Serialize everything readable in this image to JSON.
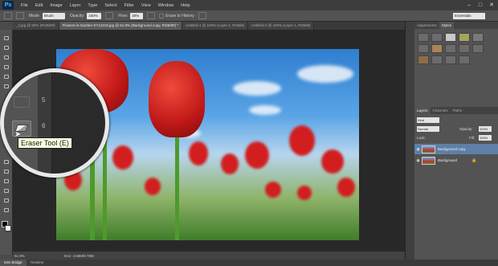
{
  "app": {
    "logo": "Ps"
  },
  "menu": [
    "File",
    "Edit",
    "Image",
    "Layer",
    "Type",
    "Select",
    "Filter",
    "View",
    "Window",
    "Help"
  ],
  "window_controls": [
    "–",
    "□",
    "✕"
  ],
  "options": {
    "mode_label": "Mode:",
    "mode_value": "Brush",
    "opacity_label": "Opacity:",
    "opacity_value": "100%",
    "flow_label": "Flow:",
    "flow_value": "30%",
    "erase_history": "Erase to History",
    "workspace": "Essentials"
  },
  "tabs": [
    "_2.jpg @ 50% (RGB/8#)",
    "Flowers-in-Garden-SY12318.jpg @ 51.9% (Background copy, RGB/8#) *",
    "Untitled-1 @ 100% (Layer 1, RGB/8)",
    "Untitled-2 @ 100% (Layer 1, RGB/8)"
  ],
  "magnifier": {
    "ruler_top": "5",
    "ruler_mid": "6"
  },
  "tooltip": "Eraser Tool (E)",
  "status": {
    "zoom": "51.9%",
    "doc": "Doc: 4.58M/9.78M"
  },
  "bottom_tabs": [
    "Mini Bridge",
    "Timeline"
  ],
  "panels": {
    "top_tabs": [
      "Adjustments",
      "Styles"
    ],
    "layer_tabs": [
      "Layers",
      "Channels",
      "Paths"
    ],
    "kind": "Kind",
    "blend": "Normal",
    "opacity_label": "Opacity:",
    "opacity_value": "100%",
    "lock_label": "Lock:",
    "fill_label": "Fill:",
    "fill_value": "100%",
    "layers": [
      {
        "name": "Background copy",
        "selected": true
      },
      {
        "name": "Background",
        "selected": false
      }
    ]
  },
  "colors": {
    "accent": "#5e7fa6",
    "tooltip_bg": "#ffffe1"
  }
}
